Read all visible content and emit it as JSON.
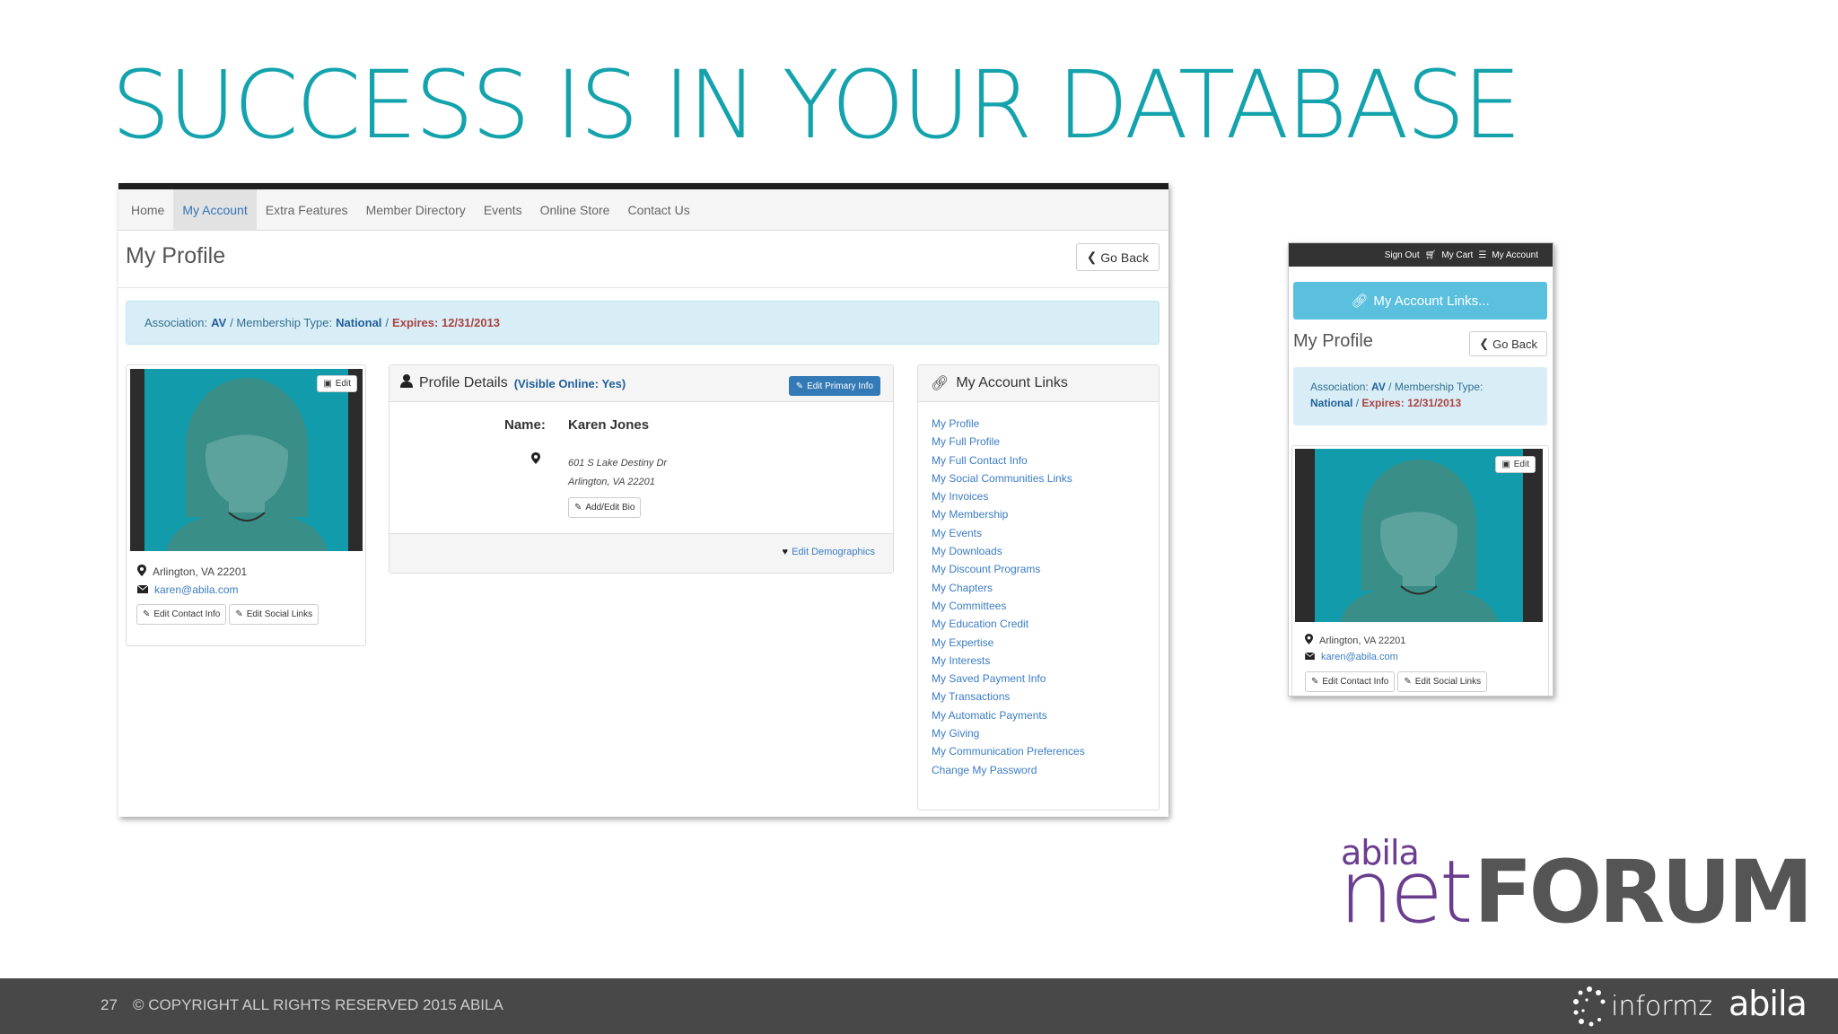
{
  "slide": {
    "title": "SUCCESS IS IN YOUR DATABASE",
    "page_number": "27",
    "copyright": "© COPYRIGHT ALL RIGHTS RESERVED 2015 ABILA"
  },
  "desktop": {
    "nav": [
      "Home",
      "My Account",
      "Extra Features",
      "Member Directory",
      "Events",
      "Online Store",
      "Contact Us"
    ],
    "active_nav": "My Account",
    "page_title": "My Profile",
    "go_back": "Go Back",
    "alert": {
      "association_label": "Association:",
      "association": "AV",
      "membership_label": "/ Membership Type:",
      "membership": "National",
      "sep": "/",
      "expires": "Expires: 12/31/2013"
    },
    "profile_card": {
      "edit_image": "Edit",
      "location": "Arlington, VA 22201",
      "email": "karen@abila.com",
      "edit_contact": "Edit Contact Info",
      "edit_social": "Edit Social Links"
    },
    "details": {
      "title": "Profile Details",
      "visible": "(Visible Online: Yes)",
      "edit_primary": "Edit Primary Info",
      "name_label": "Name:",
      "name": "Karen Jones",
      "address_1": "601 S Lake Destiny Dr",
      "address_2": "Arlington, VA 22201",
      "bio_button": "Add/Edit Bio",
      "demographics": "Edit Demographics"
    },
    "account_links": {
      "title": "My Account Links",
      "items": [
        "My Profile",
        "My Full Profile",
        "My Full Contact Info",
        "My Social Communities Links",
        "My Invoices",
        "My Membership",
        "My Events",
        "My Downloads",
        "My Discount Programs",
        "My Chapters",
        "My Committees",
        "My Education Credit",
        "My Expertise",
        "My Interests",
        "My Saved Payment Info",
        "My Transactions",
        "My Automatic Payments",
        "My Giving",
        "My Communication Preferences",
        "Change My Password"
      ]
    }
  },
  "mobile": {
    "top_bar": {
      "sign_out": "Sign Out",
      "cart": "My Cart",
      "account": "My Account"
    },
    "links_button": "My Account Links...",
    "page_title": "My Profile",
    "go_back": "Go Back",
    "alert": {
      "association_label": "Association:",
      "association": "AV",
      "membership_label": "/ Membership Type:",
      "membership": "National",
      "sep": "/",
      "expires": "Expires: 12/31/2013"
    },
    "profile_card": {
      "edit_image": "Edit",
      "location": "Arlington, VA 22201",
      "email": "karen@abila.com",
      "edit_contact": "Edit Contact Info",
      "edit_social": "Edit Social Links"
    }
  },
  "logos": {
    "netforum_abila": "abila",
    "netforum_net": "net",
    "netforum_forum": "FORUM",
    "informz": "informz",
    "footer_abila": "abila"
  },
  "colors": {
    "title_teal": "#14a3ad",
    "link_blue": "#3b7cc4",
    "alert_bg": "#d9edf7",
    "netforum_purple": "#6b3d8e",
    "footer_bg": "#484848"
  }
}
